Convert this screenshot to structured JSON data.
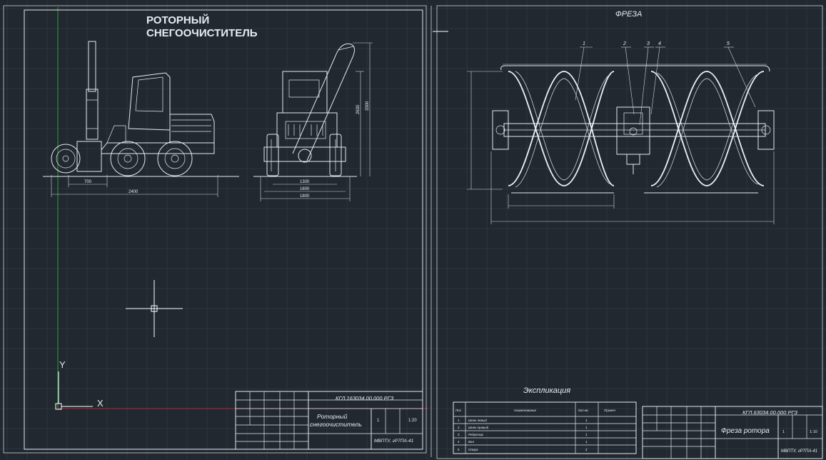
{
  "sheet_left": {
    "title_line1": "РОТОРНЫЙ",
    "title_line2": "СНЕГООЧИСТИТЕЛЬ",
    "dims": {
      "side_offset": "700",
      "side_wheelbase": "2400",
      "front_height_a": "2630",
      "front_height_b": "3300",
      "front_track": "1300",
      "front_width_a": "1600",
      "front_width_b": "1800"
    },
    "title_block": {
      "code": "КГЛ.163034.00.000 РГЗ",
      "name_line1": "Роторный",
      "name_line2": "снегоочиститель",
      "scale": "1:20",
      "sheet_no": "1",
      "org": "МВПТУ, гР7ПА-41"
    }
  },
  "sheet_right": {
    "title": "ФРЕЗА",
    "callouts": [
      "1",
      "2",
      "3",
      "4",
      "5"
    ],
    "explication_title": "Экспликация",
    "explication": {
      "headers": [
        "Поз",
        "Наименование",
        "Кол-во",
        "Примеч"
      ],
      "rows": [
        {
          "pos": "1",
          "name": "Шнек левый",
          "qty": "1"
        },
        {
          "pos": "2",
          "name": "Шнек правый",
          "qty": "1"
        },
        {
          "pos": "3",
          "name": "Редуктор",
          "qty": "1"
        },
        {
          "pos": "4",
          "name": "Вал",
          "qty": "1"
        },
        {
          "pos": "5",
          "name": "Опора",
          "qty": "2"
        }
      ]
    },
    "title_block": {
      "code": "КГЛ.63034.00.000 РГЗ",
      "name": "Фреза ротора",
      "scale": "1:10",
      "sheet_no": "1",
      "org": "МВПТУ, гР7ПА-41"
    }
  },
  "ucs": {
    "x_label": "X",
    "y_label": "Y"
  },
  "colors": {
    "background": "#212830",
    "lines": "#e6e9ec",
    "grid": "#2c343d",
    "x_axis": "#b3263a",
    "y_axis": "#2f9e41"
  }
}
